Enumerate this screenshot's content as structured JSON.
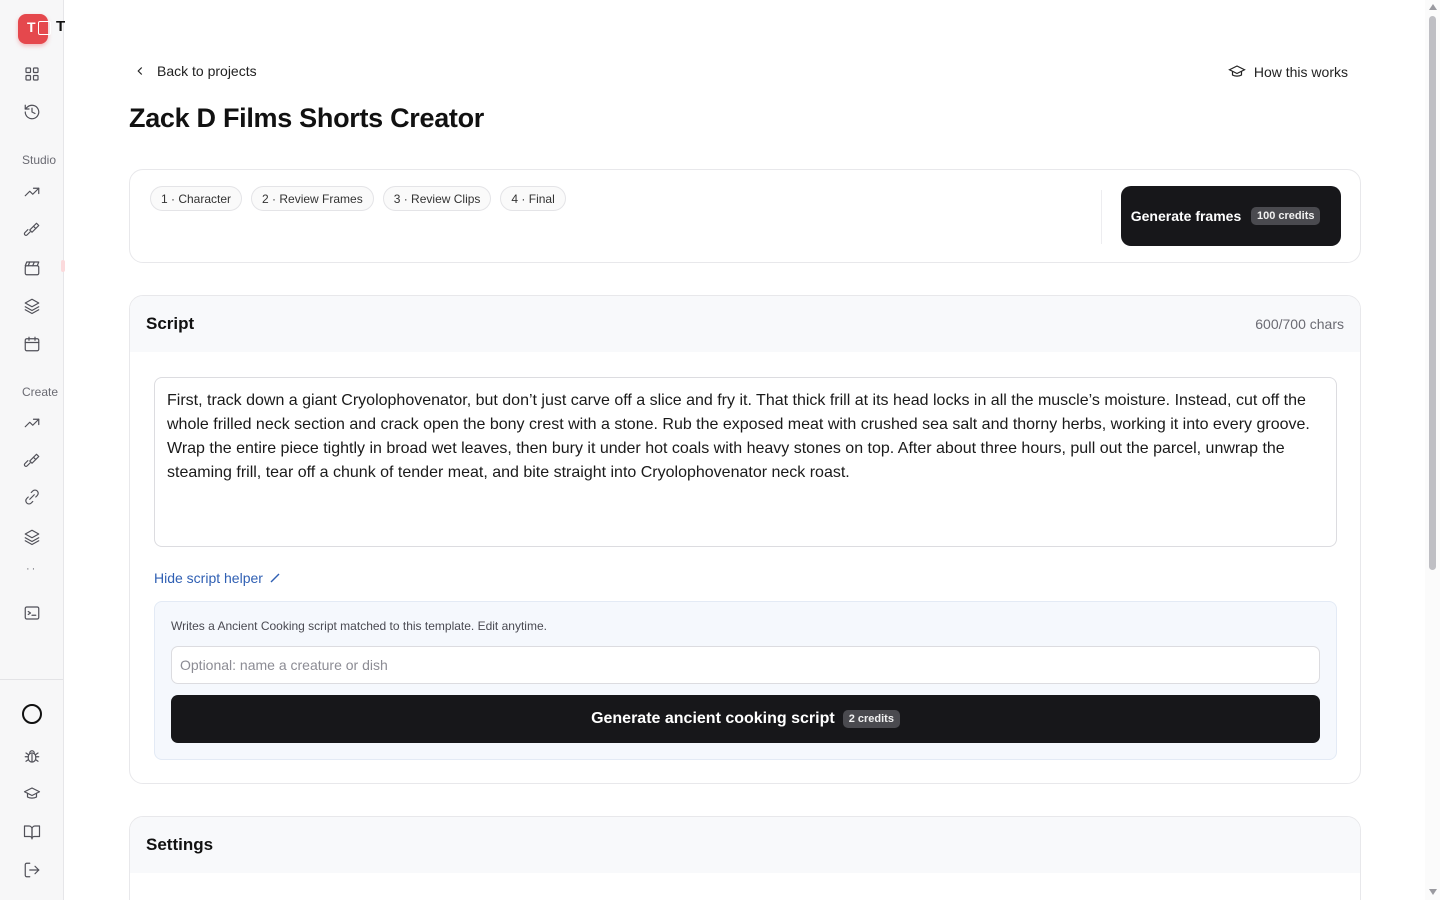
{
  "app": {
    "logo_letter": "T",
    "logo_trailing": "T"
  },
  "sidebar": {
    "section_studio": "Studio",
    "section_create": "Create",
    "more_dots": "··",
    "icons": [
      "grid-icon",
      "history-icon",
      "trending-icon",
      "brush-icon",
      "clapperboard-icon",
      "layers-icon",
      "calendar-icon",
      "trending-icon",
      "brush-icon",
      "link-icon",
      "layers-icon",
      "terminal-icon",
      "circle-icon",
      "bug-icon",
      "graduation-cap-icon",
      "book-icon",
      "logout-icon"
    ]
  },
  "header": {
    "back_label": "Back to projects",
    "how_label": "How this works",
    "title": "Zack D Films Shorts Creator"
  },
  "steps": {
    "items": [
      "1 · Character",
      "2 · Review Frames",
      "3 · Review Clips",
      "4 · Final"
    ],
    "generate_label": "Generate frames",
    "generate_credits": "100 credits"
  },
  "script": {
    "heading": "Script",
    "char_count": "600/700 chars",
    "text": "First, track down a giant Cryolophovenator, but don’t just carve off a slice and fry it. That thick frill at its head locks in all the muscle’s moisture. Instead, cut off the whole frilled neck section and crack open the bony crest with a stone. Rub the exposed meat with crushed sea salt and thorny herbs, working it into every groove. Wrap the entire piece tightly in broad wet leaves, then bury it under hot coals with heavy stones on top. After about three hours, pull out the parcel, unwrap the steaming frill, tear off a chunk of tender meat, and bite straight into Cryolophovenator neck roast.",
    "hide_helper_label": "Hide script helper",
    "helper_description": "Writes a Ancient Cooking script matched to this template. Edit anytime.",
    "helper_placeholder": "Optional: name a creature or dish",
    "helper_value": "",
    "generate_label": "Generate ancient cooking script",
    "generate_credits": "2 credits"
  },
  "settings": {
    "heading": "Settings"
  },
  "colors": {
    "accent_red": "#e5484d",
    "button_dark": "#17171a",
    "link_blue": "#2f5fb3",
    "helper_bg": "#f5f8fd"
  }
}
